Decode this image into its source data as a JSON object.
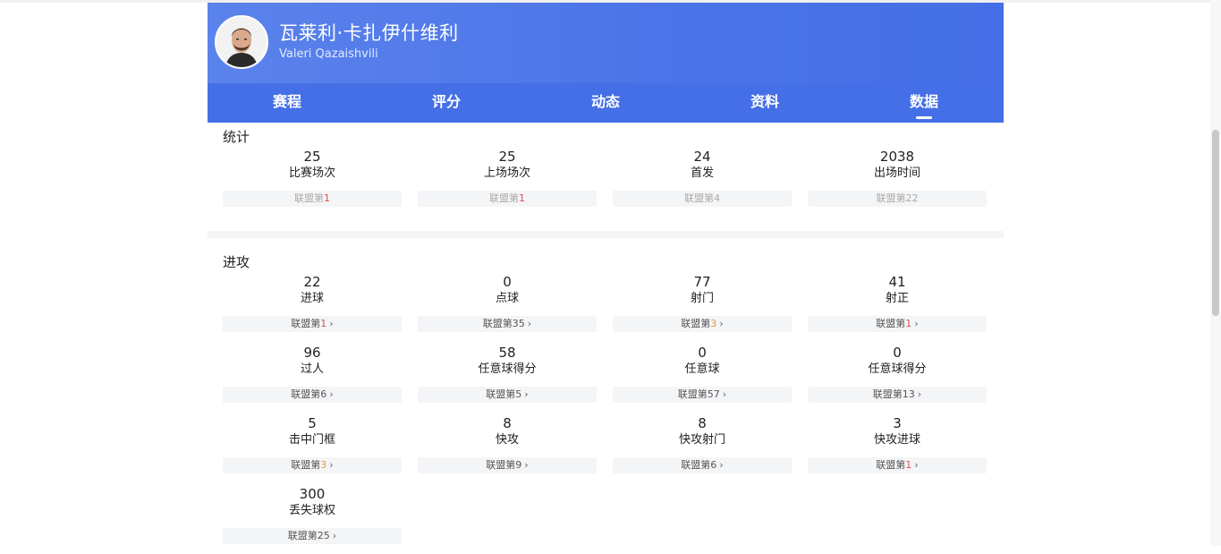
{
  "player": {
    "name_cn": "瓦莱利·卡扎伊什维利",
    "name_en": "Valeri Qazaishvili"
  },
  "tabs": [
    {
      "label": "赛程",
      "active": false
    },
    {
      "label": "评分",
      "active": false
    },
    {
      "label": "动态",
      "active": false
    },
    {
      "label": "资料",
      "active": false
    },
    {
      "label": "数据",
      "active": true
    }
  ],
  "rank_prefix": "联盟第",
  "sections": {
    "stats": {
      "title": "统计",
      "items": [
        {
          "value": "25",
          "label": "比赛场次",
          "rank": "1",
          "highlight": "red"
        },
        {
          "value": "25",
          "label": "上场场次",
          "rank": "1",
          "highlight": "red"
        },
        {
          "value": "24",
          "label": "首发",
          "rank": "4",
          "highlight": ""
        },
        {
          "value": "2038",
          "label": "出场时间",
          "rank": "22",
          "highlight": ""
        }
      ]
    },
    "attack": {
      "title": "进攻",
      "items": [
        {
          "value": "22",
          "label": "进球",
          "rank": "1",
          "highlight": "red"
        },
        {
          "value": "0",
          "label": "点球",
          "rank": "35",
          "highlight": ""
        },
        {
          "value": "77",
          "label": "射门",
          "rank": "3",
          "highlight": "orange"
        },
        {
          "value": "41",
          "label": "射正",
          "rank": "1",
          "highlight": "red"
        },
        {
          "value": "96",
          "label": "过人",
          "rank": "6",
          "highlight": ""
        },
        {
          "value": "58",
          "label": "任意球得分",
          "rank": "5",
          "highlight": ""
        },
        {
          "value": "0",
          "label": "任意球",
          "rank": "57",
          "highlight": ""
        },
        {
          "value": "0",
          "label": "任意球得分",
          "rank": "13",
          "highlight": ""
        },
        {
          "value": "5",
          "label": "击中门框",
          "rank": "3",
          "highlight": "orange"
        },
        {
          "value": "8",
          "label": "快攻",
          "rank": "9",
          "highlight": ""
        },
        {
          "value": "8",
          "label": "快攻射门",
          "rank": "6",
          "highlight": ""
        },
        {
          "value": "3",
          "label": "快攻进球",
          "rank": "1",
          "highlight": "red"
        },
        {
          "value": "300",
          "label": "丢失球权",
          "rank": "25",
          "highlight": ""
        }
      ]
    }
  },
  "icons": {
    "chevron": "chevron-right-icon",
    "chevron_glyph": "›"
  },
  "colors": {
    "header_blue": "#4a73e8",
    "rank_red": "#e44b4b",
    "rank_orange": "#e89a2f"
  }
}
